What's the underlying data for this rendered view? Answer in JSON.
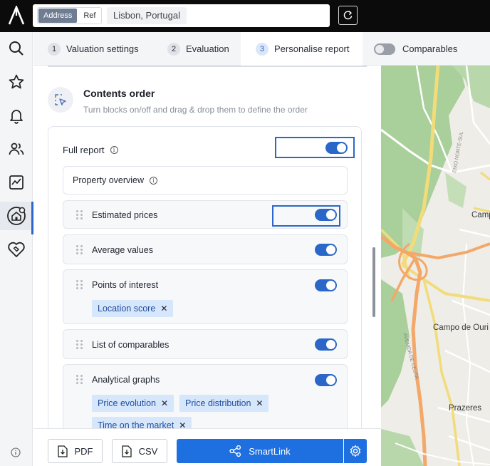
{
  "search": {
    "mode_address": "Address",
    "mode_ref": "Ref",
    "location": "Lisbon, Portugal"
  },
  "tabs": [
    {
      "num": "1",
      "label": "Valuation settings"
    },
    {
      "num": "2",
      "label": "Evaluation"
    },
    {
      "num": "3",
      "label": "Personalise report"
    }
  ],
  "comparables_label": "Comparables",
  "section": {
    "title": "Contents order",
    "subtitle": "Turn blocks on/off and drag & drop them to define the order"
  },
  "full_report_label": "Full report",
  "blocks": {
    "property_overview": "Property overview",
    "estimated_prices": "Estimated prices",
    "average_values": "Average values",
    "points_of_interest": "Points of interest",
    "list_of_comparables": "List of comparables",
    "analytical_graphs": "Analytical graphs"
  },
  "chips": {
    "location_score": "Location score",
    "price_evolution": "Price evolution",
    "price_distribution": "Price distribution",
    "time_on_market": "Time on the market",
    "remove_glyph": "✕"
  },
  "buttons": {
    "pdf": "PDF",
    "csv": "CSV",
    "smartlink": "SmartLink"
  },
  "map_labels": {
    "camp": "Camp",
    "campo": "Campo de Ouri",
    "prazeres": "Prazeres",
    "street_1": "EIXO NORTE-SUL",
    "street_2": "AVENIDA DE CEUTA"
  },
  "colors": {
    "accent": "#2a67c9",
    "primary_button": "#1e6fe0",
    "chip_bg": "#d6e6fb",
    "map_green": "#a9cf9a",
    "map_road": "#f3a86a"
  }
}
